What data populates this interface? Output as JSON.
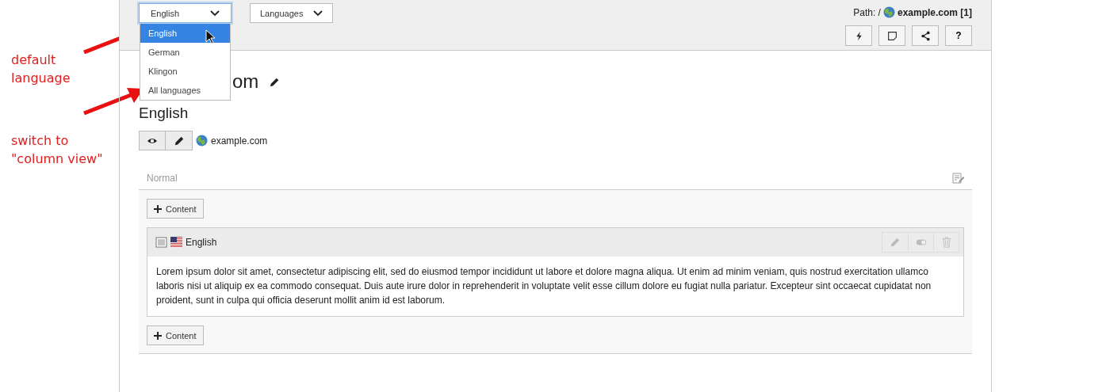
{
  "annotations": [
    {
      "text": "default\nlanguage"
    },
    {
      "text": "switch to\n\"column view\""
    }
  ],
  "header": {
    "language_select": {
      "value": "English",
      "focused": true
    },
    "languages_button": "Languages",
    "path_label": "Path: /",
    "path_page": "example.com [1]",
    "toolbar_buttons": [
      {
        "kind": "bolt"
      },
      {
        "kind": "note"
      },
      {
        "kind": "share"
      },
      {
        "kind": "text",
        "label": "?"
      }
    ]
  },
  "language_dropdown": [
    {
      "label": "English",
      "selected": true
    },
    {
      "label": "German",
      "selected": false
    },
    {
      "label": "Klingon",
      "selected": false
    },
    {
      "label": "All languages",
      "selected": false
    }
  ],
  "page_title": "om",
  "language_heading": "English",
  "view_buttons": [
    {
      "kind": "view"
    },
    {
      "kind": "edit"
    }
  ],
  "site_name": "example.com",
  "column": {
    "name": "Normal"
  },
  "add_content_buttons": [
    "Content",
    "Content"
  ],
  "content_element": {
    "language": "English",
    "hidden": false,
    "text": "Lorem ipsum dolor sit amet, consectetur adipiscing elit, sed do eiusmod tempor incididunt ut labore et dolore magna aliqua. Ut enim ad minim veniam, quis nostrud exercitation ullamco laboris nisi ut aliquip ex ea commodo consequat. Duis aute irure dolor in reprehenderit in voluptate velit esse cillum dolore eu fugiat nulla pariatur. Excepteur sint occaecat cupidatat non proident, sunt in culpa qui officia deserunt mollit anim id est laborum."
  }
}
